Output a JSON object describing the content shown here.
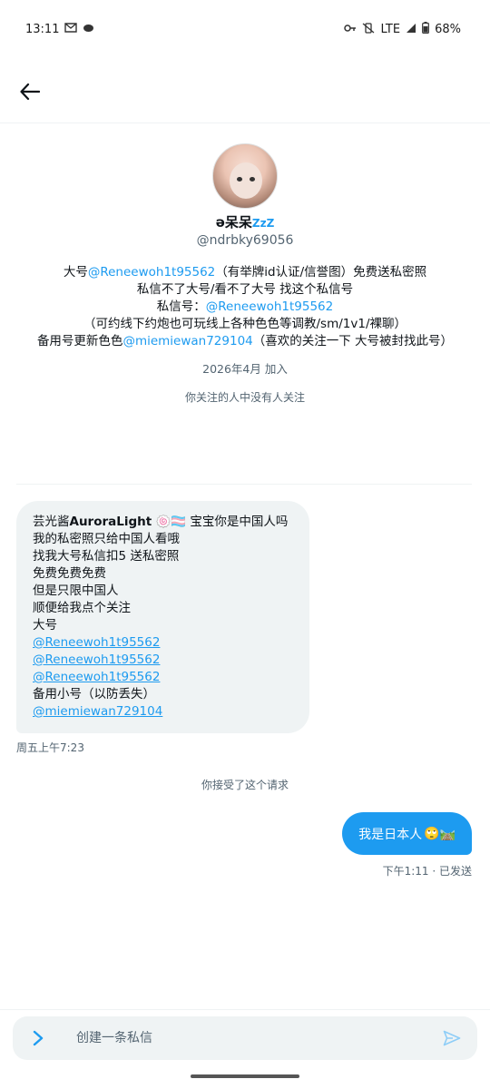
{
  "status_bar": {
    "time": "13:11",
    "left_icons": [
      "mail-icon",
      "cloud-icon"
    ],
    "network": "LTE",
    "battery": "68%"
  },
  "profile": {
    "display_name": "ə呆呆",
    "display_name_suffix": "ZzZ",
    "handle": "@ndrbky69056",
    "bio": {
      "line1_prefix": "大号",
      "line1_link": "@Reneewoh1t95562",
      "line1_suffix": "（有举牌id认证/信誉图）免费送私密照",
      "line2": "私信不了大号/看不了大号 找这个私信号",
      "line3_prefix": "私信号：",
      "line3_link": "@Reneewoh1t95562",
      "line4": "（可约线下约炮也可玩线上各种色色等调教/sm/1v1/裸聊）",
      "line5_prefix": "备用号更新色色",
      "line5_link": "@miemiewan729104",
      "line5_suffix": "（喜欢的关注一下 大号被封找此号）"
    },
    "joined": "2026年4月 加入",
    "followers_note": "你关注的人中没有人关注"
  },
  "messages": {
    "incoming": {
      "name_prefix": "芸光酱",
      "name_bold": "AuroraLight",
      "name_emojis": "🍥🏳️‍⚧️",
      "line1_rest": " 宝宝你是中国人吗",
      "line2": "我的私密照只给中国人看哦",
      "line3": "找我大号私信扣5 送私密照",
      "line4": "免费免费免费",
      "line5": "但是只限中国人",
      "line6": "顺便给我点个关注",
      "line7": "大号",
      "link1": "@Reneewoh1t95562",
      "link2": "@Reneewoh1t95562",
      "link3": "@Reneewoh1t95562",
      "line8": "备用小号（以防丢失）",
      "link4": "@miemiewan729104",
      "time": "周五上午7:23"
    },
    "accepted_notice": "你接受了这个请求",
    "outgoing": {
      "text": "我是日本人",
      "emojis": "🙄🛤️",
      "meta": "下午1:11 · 已发送"
    }
  },
  "composer": {
    "placeholder": "创建一条私信"
  },
  "colors": {
    "accent": "#1d9bf0",
    "bubble_in": "#eff3f4",
    "muted_text": "#536471"
  }
}
